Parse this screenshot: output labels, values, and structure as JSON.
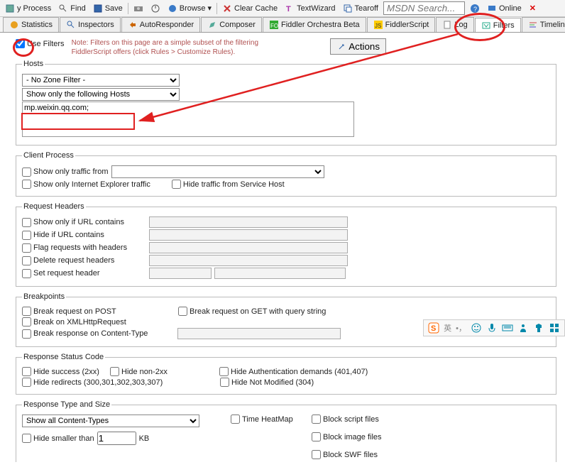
{
  "toolbar": {
    "process": "y Process",
    "find": "Find",
    "save": "Save",
    "browse": "Browse",
    "clear_cache": "Clear Cache",
    "textwizard": "TextWizard",
    "tearoff": "Tearoff",
    "search_ph": "MSDN Search...",
    "online": "Online"
  },
  "tabs": {
    "statistics": "Statistics",
    "inspectors": "Inspectors",
    "autoresponder": "AutoResponder",
    "composer": "Composer",
    "orchestra": "Fiddler Orchestra Beta",
    "fiddlerscript": "FiddlerScript",
    "log": "Log",
    "filters": "Filters",
    "timeline": "Timeline"
  },
  "use_filters": "Use Filters",
  "note1": "Note: Filters on this page are a simple subset of the filtering",
  "note2": "FiddlerScript offers (click Rules > Customize Rules).",
  "actions": "Actions",
  "hosts": {
    "legend": "Hosts",
    "zone_filter": "- No Zone Filter -",
    "host_filter": "Show only the following Hosts",
    "host_list": "mp.weixin.qq.com;"
  },
  "client": {
    "legend": "Client Process",
    "show_only": "Show only traffic from",
    "show_ie": "Show only Internet Explorer traffic",
    "hide_svc": "Hide traffic from Service Host"
  },
  "req": {
    "legend": "Request Headers",
    "url_contains": "Show only if URL contains",
    "hide_url": "Hide if URL contains",
    "flag_hdr": "Flag requests with headers",
    "del_hdr": "Delete request headers",
    "set_hdr": "Set request header"
  },
  "bp": {
    "legend": "Breakpoints",
    "post": "Break request on POST",
    "get": "Break request on GET with query string",
    "xhr": "Break on XMLHttpRequest",
    "ct": "Break response on Content-Type"
  },
  "status": {
    "legend": "Response Status Code",
    "success": "Hide success (2xx)",
    "non2xx": "Hide non-2xx",
    "auth": "Hide Authentication demands (401,407)",
    "redirects": "Hide redirects (300,301,302,303,307)",
    "notmod": "Hide Not Modified (304)"
  },
  "resp": {
    "legend": "Response Type and Size",
    "ct_all": "Show all Content-Types",
    "heatmap": "Time HeatMap",
    "block_script": "Block script files",
    "block_img": "Block image files",
    "block_swf": "Block SWF files",
    "hide_smaller": "Hide smaller than",
    "kb": "KB",
    "size_val": "1"
  },
  "ime": "英"
}
